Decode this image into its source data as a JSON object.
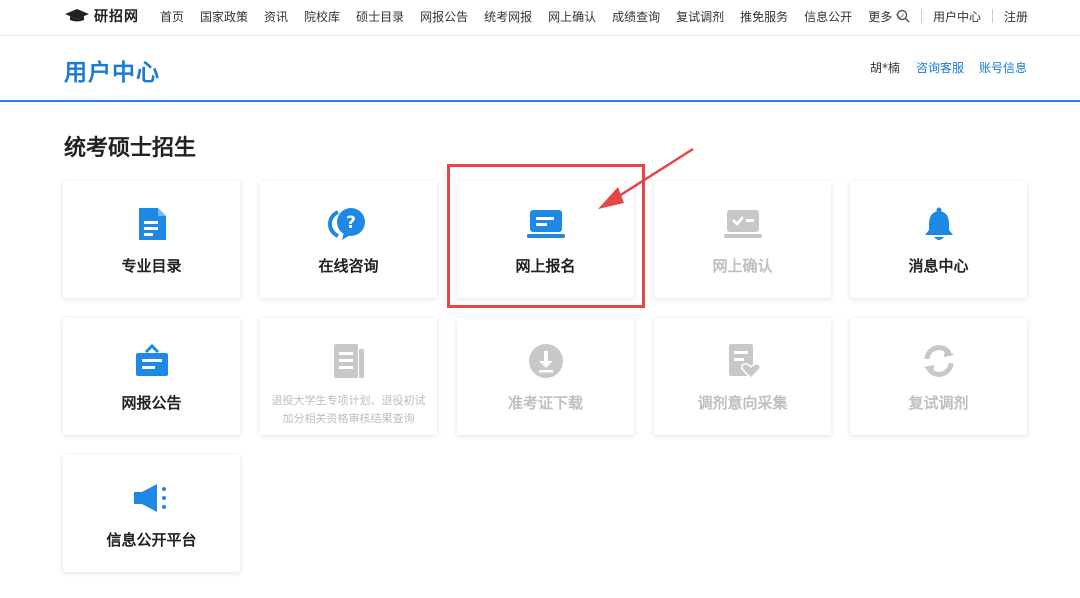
{
  "nav": {
    "logo": "研招网",
    "links": [
      "首页",
      "国家政策",
      "资讯",
      "院校库",
      "硕士目录",
      "网报公告",
      "统考网报",
      "网上确认",
      "成绩查询",
      "复试调剂",
      "推免服务",
      "信息公开"
    ],
    "more": "更多",
    "user_center": "用户中心",
    "register": "注册"
  },
  "header": {
    "title": "用户中心",
    "user": "胡*楠",
    "consult": "咨询客服",
    "account": "账号信息"
  },
  "section": {
    "title": "统考硕士招生"
  },
  "cards": [
    {
      "label": "专业目录",
      "icon": "document-icon",
      "enabled": true
    },
    {
      "label": "在线咨询",
      "icon": "question-chat-icon",
      "enabled": true
    },
    {
      "label": "网上报名",
      "icon": "laptop-icon",
      "enabled": true
    },
    {
      "label": "网上确认",
      "icon": "checklist-screen-icon",
      "enabled": false
    },
    {
      "label": "消息中心",
      "icon": "bell-icon",
      "enabled": true
    },
    {
      "label": "网报公告",
      "icon": "briefcase-icon",
      "enabled": true
    },
    {
      "label": "退役大学生专项计划、退役初试加分相关资格审核结果查询",
      "icon": "notes-icon",
      "enabled": false
    },
    {
      "label": "准考证下载",
      "icon": "download-icon",
      "enabled": false
    },
    {
      "label": "调剂意向采集",
      "icon": "heart-doc-icon",
      "enabled": false
    },
    {
      "label": "复试调剂",
      "icon": "refresh-icon",
      "enabled": false
    },
    {
      "label": "信息公开平台",
      "icon": "megaphone-icon",
      "enabled": true
    }
  ],
  "colors": {
    "accent": "#1a7bd6",
    "icon_blue": "#1e88e5",
    "disabled": "#c8c8c8",
    "highlight": "#e64646"
  }
}
